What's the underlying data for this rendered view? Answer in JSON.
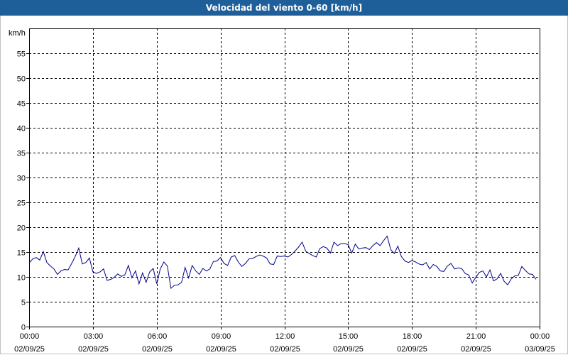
{
  "chart_data": {
    "type": "line",
    "title": "Velocidad del viento 0-60 [km/h]",
    "ylabel": "km/h",
    "ylim": [
      0,
      60
    ],
    "yticks": [
      0,
      5,
      10,
      15,
      20,
      25,
      30,
      35,
      40,
      45,
      50,
      55
    ],
    "xlim": [
      "02/09/25 00:00",
      "03/09/25 00:00"
    ],
    "xticks": [
      {
        "time": "00:00",
        "date": "02/09/25"
      },
      {
        "time": "03:00",
        "date": "02/09/25"
      },
      {
        "time": "06:00",
        "date": "02/09/25"
      },
      {
        "time": "09:00",
        "date": "02/09/25"
      },
      {
        "time": "12:00",
        "date": "02/09/25"
      },
      {
        "time": "15:00",
        "date": "02/09/25"
      },
      {
        "time": "18:00",
        "date": "02/09/25"
      },
      {
        "time": "21:00",
        "date": "02/09/25"
      },
      {
        "time": "00:00",
        "date": "03/09/25"
      }
    ],
    "grid": true,
    "line_color": "#00008b",
    "series": [
      {
        "x": [
          "00:00",
          "00:10",
          "00:20",
          "00:30",
          "00:40",
          "00:50",
          "01:00",
          "01:10",
          "01:20",
          "01:30",
          "01:40",
          "01:50",
          "02:00",
          "02:10",
          "02:20",
          "02:30",
          "02:40",
          "02:50",
          "03:00",
          "03:10",
          "03:20",
          "03:30",
          "03:40",
          "03:50",
          "04:00",
          "04:10",
          "04:20",
          "04:30",
          "04:40",
          "04:50",
          "05:00",
          "05:10",
          "05:20",
          "05:30",
          "05:40",
          "05:50",
          "06:00",
          "06:10",
          "06:20",
          "06:30",
          "06:40",
          "06:50",
          "07:00",
          "07:10",
          "07:20",
          "07:30",
          "07:40",
          "07:50",
          "08:00",
          "08:10",
          "08:20",
          "08:30",
          "08:40",
          "08:50",
          "09:00",
          "09:10",
          "09:20",
          "09:30",
          "09:40",
          "09:50",
          "10:00",
          "10:10",
          "10:20",
          "10:30",
          "10:40",
          "10:50",
          "11:00",
          "11:10",
          "11:20",
          "11:30",
          "11:40",
          "11:50",
          "12:00",
          "12:10",
          "12:20",
          "12:30",
          "12:40",
          "12:50",
          "13:00",
          "13:10",
          "13:20",
          "13:30",
          "13:40",
          "13:50",
          "14:00",
          "14:10",
          "14:20",
          "14:30",
          "14:40",
          "14:50",
          "15:00",
          "15:10",
          "15:20",
          "15:30",
          "15:40",
          "15:50",
          "16:00",
          "16:10",
          "16:20",
          "16:30",
          "16:40",
          "16:50",
          "17:00",
          "17:10",
          "17:20",
          "17:30",
          "17:40",
          "17:50",
          "18:00",
          "18:10",
          "18:20",
          "18:30",
          "18:40",
          "18:50",
          "19:00",
          "19:10",
          "19:20",
          "19:30",
          "19:40",
          "19:50",
          "20:00",
          "20:10",
          "20:20",
          "20:30",
          "20:40",
          "20:50",
          "21:00",
          "21:10",
          "21:20",
          "21:30",
          "21:40",
          "21:50",
          "22:00",
          "22:10",
          "22:20",
          "22:30",
          "22:40",
          "22:50",
          "23:00",
          "23:10",
          "23:20",
          "23:30",
          "23:40",
          "23:50"
        ],
        "values": [
          12.8,
          13.6,
          13.9,
          13.4,
          15.1,
          12.9,
          12.2,
          11.6,
          10.5,
          11.2,
          11.5,
          11.4,
          12.7,
          14.1,
          15.8,
          12.6,
          12.9,
          13.8,
          11.0,
          10.7,
          11.0,
          11.6,
          9.3,
          9.5,
          9.9,
          10.6,
          10.1,
          10.4,
          12.3,
          9.8,
          11.2,
          8.6,
          10.8,
          8.9,
          11.0,
          11.7,
          8.6,
          11.6,
          13.0,
          12.2,
          7.7,
          8.3,
          8.4,
          8.9,
          11.9,
          9.8,
          12.3,
          11.2,
          10.5,
          11.7,
          11.2,
          11.6,
          13.1,
          13.2,
          13.9,
          12.7,
          12.3,
          14.0,
          14.3,
          13.0,
          12.1,
          12.7,
          13.6,
          13.7,
          14.1,
          14.4,
          14.2,
          13.8,
          12.6,
          12.5,
          14.2,
          14.1,
          14.2,
          14.0,
          14.5,
          15.2,
          16.0,
          17.0,
          15.2,
          14.7,
          14.3,
          14.0,
          15.7,
          16.1,
          15.8,
          14.8,
          17.0,
          16.3,
          16.7,
          16.7,
          16.5,
          14.8,
          16.6,
          15.6,
          15.8,
          15.9,
          15.5,
          16.3,
          16.9,
          16.3,
          17.3,
          18.2,
          15.5,
          14.7,
          16.2,
          14.1,
          13.2,
          12.9,
          13.3,
          13.0,
          12.6,
          12.4,
          12.9,
          11.6,
          12.5,
          12.1,
          11.2,
          11.1,
          12.2,
          12.7,
          11.6,
          11.8,
          11.7,
          10.7,
          10.4,
          8.8,
          9.9,
          10.9,
          11.2,
          10.0,
          11.4,
          9.2,
          9.6,
          10.7,
          9.1,
          8.4,
          9.6,
          10.2,
          10.3,
          12.1,
          11.3,
          10.6,
          10.5,
          9.5
        ]
      }
    ]
  }
}
